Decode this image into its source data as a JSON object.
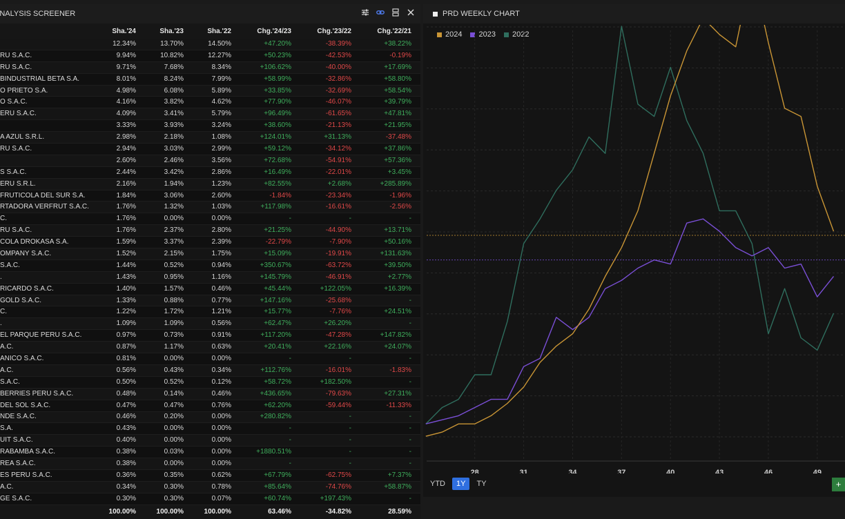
{
  "screener": {
    "title": "ANALYSIS SCREENER",
    "columns": [
      "",
      "Sha.'24",
      "Sha.'23",
      "Sha.'22",
      "Chg.'24/23",
      "Chg.'23/22",
      "Chg.'22/21"
    ],
    "rows": [
      [
        "",
        "12.34%",
        "13.70%",
        "14.50%",
        "+47.20%",
        "-38.39%",
        "+38.22%"
      ],
      [
        "RU S.A.C.",
        "9.94%",
        "10.82%",
        "12.27%",
        "+50.23%",
        "-42.53%",
        "-0.19%"
      ],
      [
        "RU S.A.C.",
        "9.71%",
        "7.68%",
        "8.34%",
        "+106.62%",
        "-40.00%",
        "+17.69%"
      ],
      [
        "BINDUSTRIAL BETA S.A.",
        "8.01%",
        "8.24%",
        "7.99%",
        "+58.99%",
        "-32.86%",
        "+58.80%"
      ],
      [
        "O PRIETO S.A.",
        "4.98%",
        "6.08%",
        "5.89%",
        "+33.85%",
        "-32.69%",
        "+58.54%"
      ],
      [
        "O S.A.C.",
        "4.16%",
        "3.82%",
        "4.62%",
        "+77.90%",
        "-46.07%",
        "+39.79%"
      ],
      [
        "ERU S.A.C.",
        "4.09%",
        "3.41%",
        "5.79%",
        "+96.49%",
        "-61.65%",
        "+47.81%"
      ],
      [
        "",
        "3.33%",
        "3.93%",
        "3.24%",
        "+38.60%",
        "-21.13%",
        "+21.95%"
      ],
      [
        "A AZUL S.R.L.",
        "2.98%",
        "2.18%",
        "1.08%",
        "+124.01%",
        "+31.13%",
        "-37.48%"
      ],
      [
        "RU S.A.C.",
        "2.94%",
        "3.03%",
        "2.99%",
        "+59.12%",
        "-34.12%",
        "+37.86%"
      ],
      [
        "",
        "2.60%",
        "2.46%",
        "3.56%",
        "+72.68%",
        "-54.91%",
        "+57.36%"
      ],
      [
        "S S.A.C.",
        "2.44%",
        "3.42%",
        "2.86%",
        "+16.49%",
        "-22.01%",
        "+3.45%"
      ],
      [
        "ERU S.R.L.",
        "2.16%",
        "1.94%",
        "1.23%",
        "+82.55%",
        "+2.68%",
        "+285.89%"
      ],
      [
        "FRUTICOLA DEL SUR S.A.",
        "1.84%",
        "3.06%",
        "2.60%",
        "-1.84%",
        "-23.34%",
        "-1.96%"
      ],
      [
        "RTADORA VERFRUT S.A.C.",
        "1.76%",
        "1.32%",
        "1.03%",
        "+117.98%",
        "-16.61%",
        "-2.56%"
      ],
      [
        "C.",
        "1.76%",
        "0.00%",
        "0.00%",
        "-",
        "-",
        "-"
      ],
      [
        "RU S.A.C.",
        "1.76%",
        "2.37%",
        "2.80%",
        "+21.25%",
        "-44.90%",
        "+13.71%"
      ],
      [
        "COLA DROKASA S.A.",
        "1.59%",
        "3.37%",
        "2.39%",
        "-22.79%",
        "-7.90%",
        "+50.16%"
      ],
      [
        "OMPANY S.A.C.",
        "1.52%",
        "2.15%",
        "1.75%",
        "+15.09%",
        "-19.91%",
        "+131.63%"
      ],
      [
        "S.A.C.",
        "1.44%",
        "0.52%",
        "0.94%",
        "+350.67%",
        "-63.72%",
        "+39.50%"
      ],
      [
        ".",
        "1.43%",
        "0.95%",
        "1.16%",
        "+145.79%",
        "-46.91%",
        "+2.77%"
      ],
      [
        "RICARDO S.A.C.",
        "1.40%",
        "1.57%",
        "0.46%",
        "+45.44%",
        "+122.05%",
        "+16.39%"
      ],
      [
        "GOLD S.A.C.",
        "1.33%",
        "0.88%",
        "0.77%",
        "+147.16%",
        "-25.68%",
        "-"
      ],
      [
        "C.",
        "1.22%",
        "1.72%",
        "1.21%",
        "+15.77%",
        "-7.76%",
        "+24.51%"
      ],
      [
        ".",
        "1.09%",
        "1.09%",
        "0.56%",
        "+62.47%",
        "+26.20%",
        "-"
      ],
      [
        "EL PARQUE PERU S.A.C.",
        "0.97%",
        "0.73%",
        "0.91%",
        "+117.20%",
        "-47.28%",
        "+147.82%"
      ],
      [
        "A.C.",
        "0.87%",
        "1.17%",
        "0.63%",
        "+20.41%",
        "+22.16%",
        "+24.07%"
      ],
      [
        "ANICO S.A.C.",
        "0.81%",
        "0.00%",
        "0.00%",
        "-",
        "-",
        "-"
      ],
      [
        "A.C.",
        "0.56%",
        "0.43%",
        "0.34%",
        "+112.76%",
        "-16.01%",
        "-1.83%"
      ],
      [
        "S.A.C.",
        "0.50%",
        "0.52%",
        "0.12%",
        "+58.72%",
        "+182.50%",
        "-"
      ],
      [
        "BERRIES PERU S.A.C.",
        "0.48%",
        "0.14%",
        "0.46%",
        "+436.65%",
        "-79.63%",
        "+27.31%"
      ],
      [
        "DEL SOL S.A.C.",
        "0.47%",
        "0.47%",
        "0.76%",
        "+62.20%",
        "-59.44%",
        "-11.33%"
      ],
      [
        "NDE S.A.C.",
        "0.46%",
        "0.20%",
        "0.00%",
        "+280.82%",
        "-",
        "-"
      ],
      [
        "S.A.",
        "0.43%",
        "0.00%",
        "0.00%",
        "-",
        "-",
        "-"
      ],
      [
        "UIT S.A.C.",
        "0.40%",
        "0.00%",
        "0.00%",
        "-",
        "-",
        "-"
      ],
      [
        "RABAMBA S.A.C.",
        "0.38%",
        "0.03%",
        "0.00%",
        "+1880.51%",
        "-",
        "-"
      ],
      [
        "REA S.A.C.",
        "0.38%",
        "0.00%",
        "0.00%",
        "-",
        "-",
        "-"
      ],
      [
        "ES PERU S.A.C.",
        "0.36%",
        "0.35%",
        "0.62%",
        "+67.79%",
        "-62.75%",
        "+7.37%"
      ],
      [
        "A.C.",
        "0.34%",
        "0.30%",
        "0.78%",
        "+85.64%",
        "-74.76%",
        "+58.87%"
      ],
      [
        "GE S.A.C.",
        "0.30%",
        "0.30%",
        "0.07%",
        "+60.74%",
        "+197.43%",
        "-"
      ]
    ],
    "totals": [
      "",
      "100.00%",
      "100.00%",
      "100.00%",
      "63.46%",
      "-34.82%",
      "28.59%"
    ]
  },
  "chart": {
    "title": "PRD WEEKLY CHART",
    "ranges": [
      "YTD",
      "1Y",
      "TY"
    ],
    "active_range": "1Y",
    "add_label": "+"
  },
  "chart_data": {
    "type": "line",
    "x": [
      25,
      26,
      27,
      28,
      29,
      30,
      31,
      32,
      33,
      34,
      35,
      36,
      37,
      38,
      39,
      40,
      41,
      42,
      43,
      44,
      45,
      46,
      47,
      48,
      49,
      50
    ],
    "xticks": [
      "28",
      "31",
      "34",
      "37",
      "40",
      "43",
      "46",
      "49"
    ],
    "xlim": [
      25.05,
      50.7
    ],
    "ylim": [
      0,
      100
    ],
    "grid": true,
    "legend_position": "top-left",
    "series": [
      {
        "name": "2024",
        "color": "#c99535",
        "values": [
          1,
          2,
          4,
          4,
          6,
          9,
          13,
          19,
          23,
          26,
          32,
          40,
          47,
          56,
          70,
          84,
          95,
          103,
          99,
          96,
          115,
          97,
          81,
          79,
          62,
          51
        ]
      },
      {
        "name": "2023",
        "color": "#7a4fd6",
        "values": [
          4,
          5,
          6,
          8,
          10,
          10,
          18,
          20,
          30,
          27,
          30,
          37,
          39,
          42,
          44,
          43,
          53,
          54,
          51,
          47,
          45,
          47,
          42,
          43,
          35,
          40
        ]
      },
      {
        "name": "2022",
        "color": "#2f6e5e",
        "values": [
          4,
          8,
          10,
          16,
          16,
          29,
          48,
          54,
          61,
          66,
          74,
          70,
          101,
          82,
          79,
          91,
          78,
          70,
          56,
          56,
          48,
          26,
          37,
          25,
          22,
          31
        ]
      }
    ],
    "reference_lines": [
      {
        "series": "2024",
        "value": 50
      },
      {
        "series": "2023",
        "value": 44
      }
    ]
  }
}
